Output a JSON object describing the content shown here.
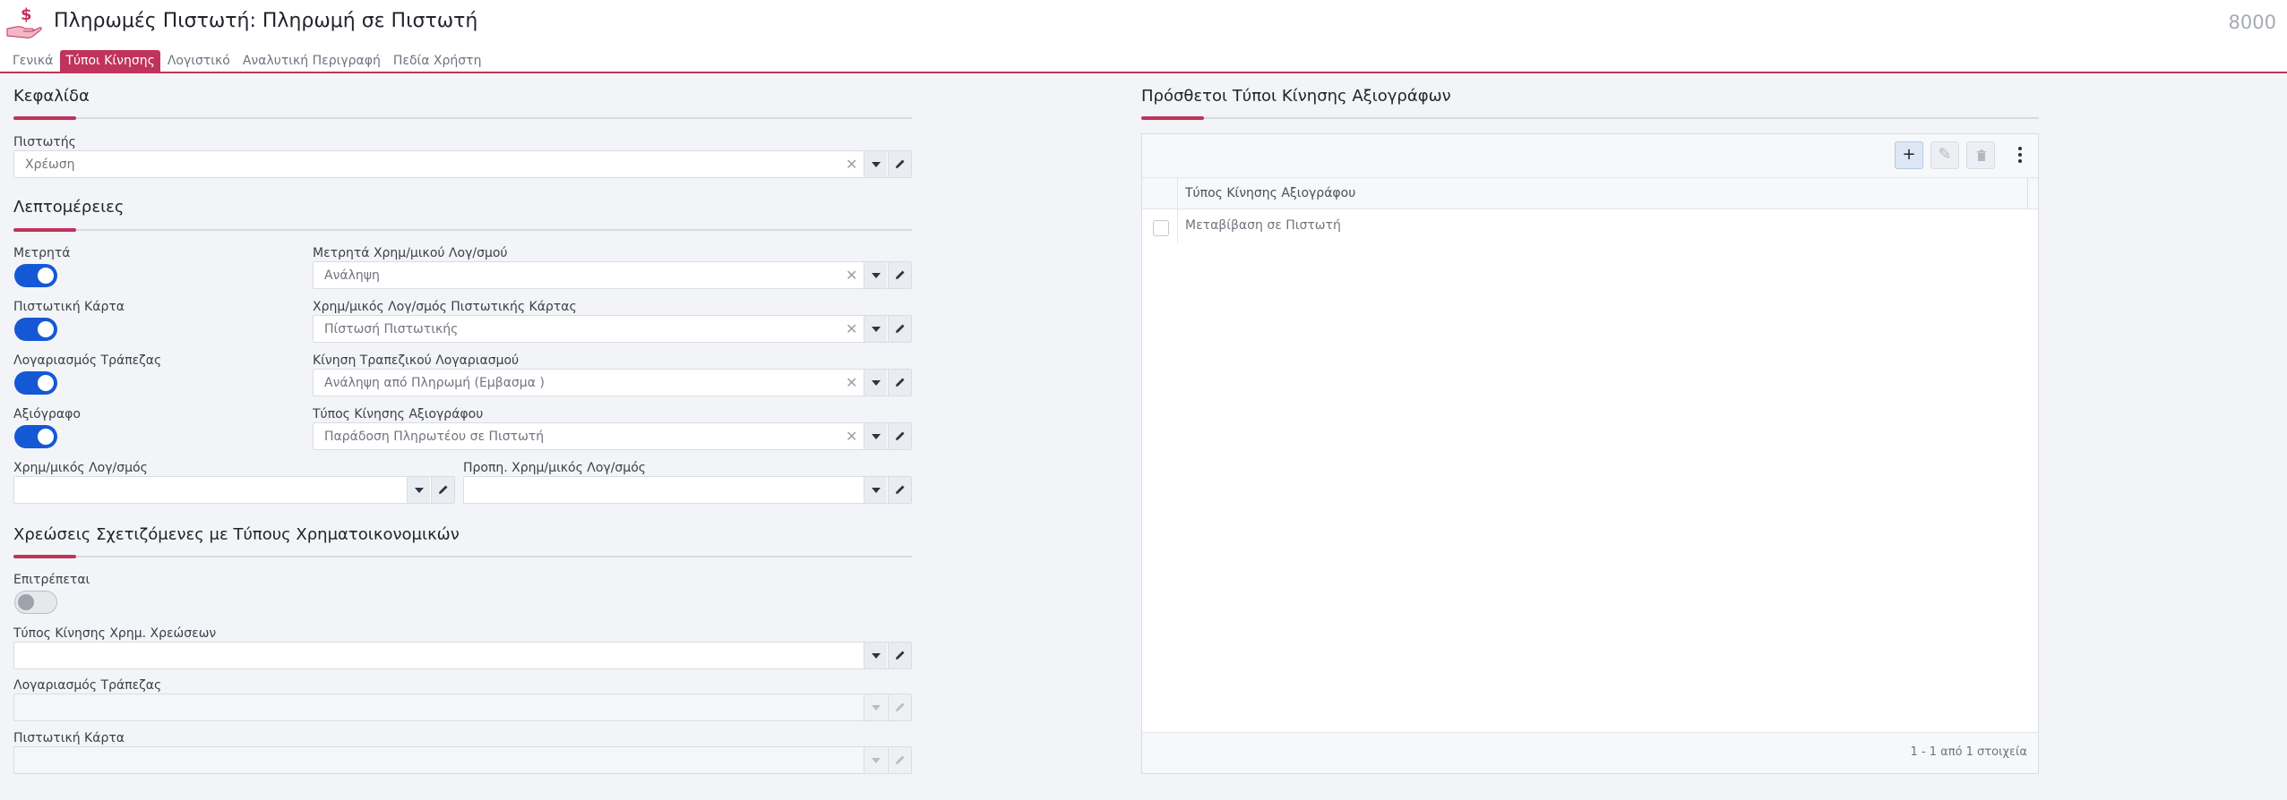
{
  "header": {
    "title": "Πληρωμές Πιστωτή: Πληρωμή σε Πιστωτή",
    "record_number": "8000",
    "icon": "hand-money-icon"
  },
  "tabs": [
    {
      "label": "Γενικά",
      "active": false
    },
    {
      "label": "Τύποι Κίνησης",
      "active": true
    },
    {
      "label": "Λογιστικό",
      "active": false
    },
    {
      "label": "Αναλυτική Περιγραφή",
      "active": false
    },
    {
      "label": "Πεδία Χρήστη",
      "active": false
    }
  ],
  "header_section": {
    "title": "Κεφαλίδα",
    "creditor": {
      "label": "Πιστωτής",
      "value": "Χρέωση"
    }
  },
  "details": {
    "title": "Λεπτομέρειες",
    "cash": {
      "label": "Μετρητά",
      "on": true
    },
    "cash_account_movement": {
      "label": "Μετρητά Χρημ/μικού Λογ/σμού",
      "value": "Ανάληψη"
    },
    "credit_card": {
      "label": "Πιστωτική Κάρτα",
      "on": true
    },
    "credit_card_account": {
      "label": "Χρημ/μικός Λογ/σμός Πιστωτικής Κάρτας",
      "value": "Πίστωσή Πιστωτικής"
    },
    "bank_account": {
      "label": "Λογαριασμός Τράπεζας",
      "on": true
    },
    "bank_movement": {
      "label": "Κίνηση Τραπεζικού Λογαριασμού",
      "value": "Ανάληψη από Πληρωμή (Εμβασμα )"
    },
    "cheque": {
      "label": "Αξιόγραφο",
      "on": true
    },
    "cheque_movement": {
      "label": "Τύπος Κίνησης Αξιογράφου",
      "value": "Παράδοση Πληρωτέου σε Πιστωτή"
    },
    "financial_account": {
      "label": "Χρημ/μικός Λογ/σμός",
      "value": ""
    },
    "prepaid_financial_account": {
      "label": "Προπη. Χρημ/μικός Λογ/σμός",
      "value": ""
    }
  },
  "charges": {
    "title": "Χρεώσεις Σχετιζόμενες με Τύπους Χρηματοικονομικών",
    "allowed": {
      "label": "Επιτρέπεται",
      "on": false
    },
    "charge_movement_type": {
      "label": "Τύπος Κίνησης Χρημ. Χρεώσεων",
      "value": ""
    },
    "bank_account": {
      "label": "Λογαριασμός Τράπεζας",
      "value": ""
    },
    "credit_card": {
      "label": "Πιστωτική Κάρτα",
      "value": ""
    }
  },
  "cheque_types": {
    "title": "Πρόσθετοι Τύποι Κίνησης Αξιογράφων",
    "column": "Τύπος Κίνησης Αξιογράφου",
    "rows": [
      "Μεταβίβαση σε Πιστωτή"
    ],
    "pager": "1 - 1 από 1 στοιχεία"
  },
  "colors": {
    "accent": "#c0335a",
    "toggle_on": "#1558d6"
  }
}
